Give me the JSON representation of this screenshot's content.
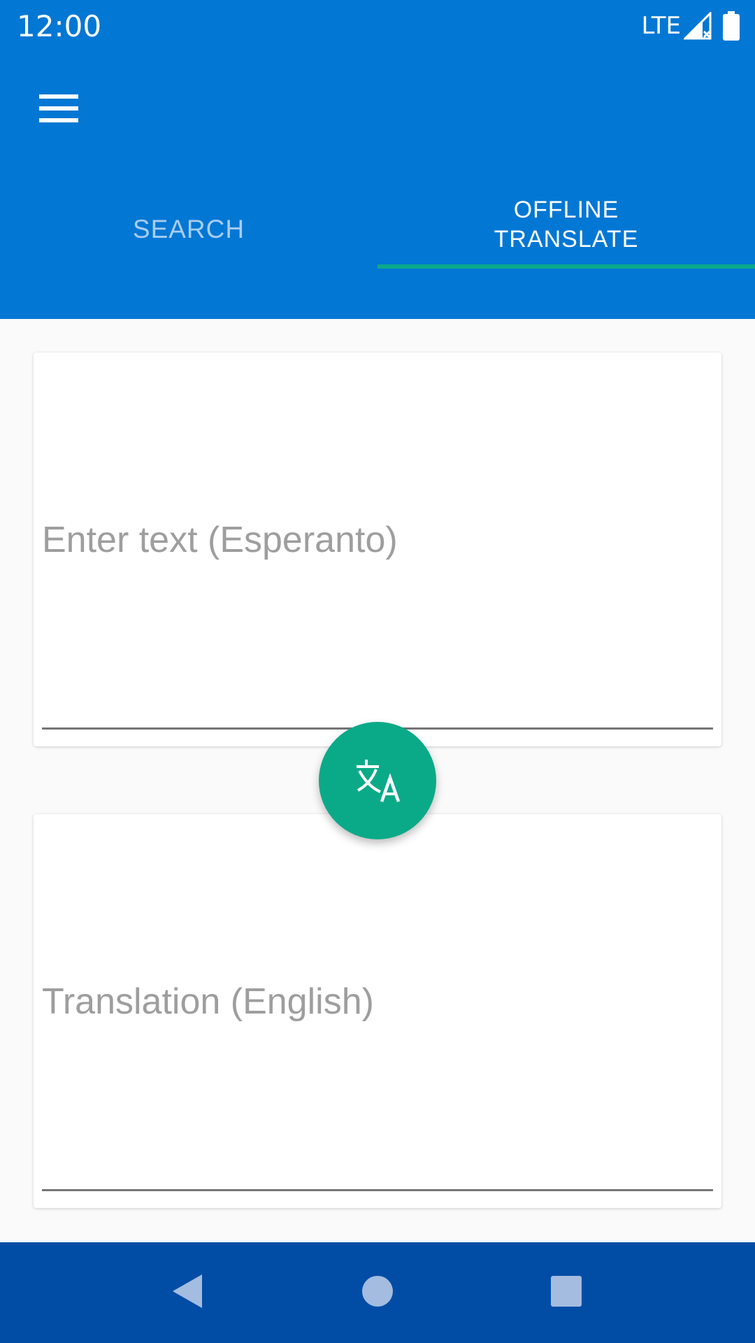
{
  "status_bar": {
    "time": "12:00",
    "network": "LTE",
    "icons": [
      "signal-icon",
      "battery-icon"
    ]
  },
  "app_bar": {
    "menu_icon": "menu-icon",
    "tabs": [
      {
        "label": "SEARCH",
        "selected": false
      },
      {
        "label": "OFFLINE\nTRANSLATE",
        "selected": true
      }
    ]
  },
  "translator": {
    "source_placeholder": "Enter text (Esperanto)",
    "source_value": "",
    "target_placeholder": "Translation (English)",
    "target_value": "",
    "translate_icon": "translate-icon"
  },
  "nav_bar": {
    "icons": [
      "back-icon",
      "home-icon",
      "recents-icon"
    ]
  },
  "colors": {
    "primary": "#0277d4",
    "primary_dark": "#014da6",
    "accent": "#0aaa88",
    "background": "#fafafa",
    "placeholder": "#9e9e9e"
  }
}
